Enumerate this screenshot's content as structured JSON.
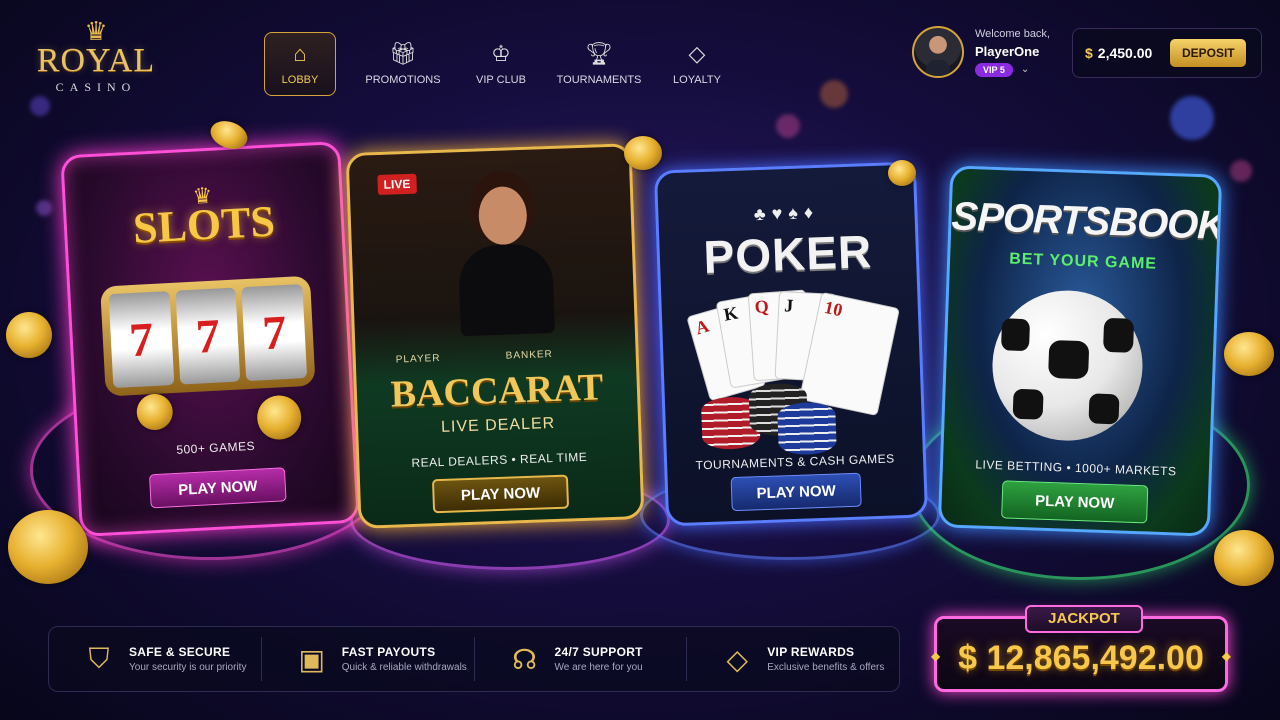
{
  "brand": {
    "name": "ROYAL",
    "tagline": "CASINO"
  },
  "nav": [
    {
      "label": "LOBBY",
      "icon": "house-icon",
      "active": true
    },
    {
      "label": "PROMOTIONS",
      "icon": "gift-icon"
    },
    {
      "label": "VIP CLUB",
      "icon": "crown-icon"
    },
    {
      "label": "TOURNAMENTS",
      "icon": "trophy-icon"
    },
    {
      "label": "LOYALTY",
      "icon": "diamond-icon"
    }
  ],
  "user": {
    "welcome": "Welcome back,",
    "name": "PlayerOne",
    "vip": "VIP 5"
  },
  "wallet": {
    "currency": "$",
    "balance": "2,450.00",
    "deposit_label": "DEPOSIT"
  },
  "cards": {
    "slots": {
      "title": "SLOTS",
      "subtitle": "500+ GAMES",
      "button": "PLAY NOW",
      "reels": [
        "7",
        "7",
        "7"
      ]
    },
    "baccarat": {
      "badge": "LIVE",
      "title": "BACCARAT",
      "tagline": "LIVE DEALER",
      "felt_left": "PLAYER",
      "felt_right": "BANKER",
      "subtitle": "REAL DEALERS • REAL TIME",
      "button": "PLAY NOW"
    },
    "poker": {
      "suits": "♣♥♠♦",
      "title": "POKER",
      "subtitle": "TOURNAMENTS & CASH GAMES",
      "button": "PLAY NOW",
      "cards": [
        "A",
        "K",
        "Q",
        "J",
        "10"
      ]
    },
    "sportsbook": {
      "title": "SPORTSBOOK",
      "tagline": "BET YOUR GAME",
      "subtitle": "LIVE BETTING • 1000+ MARKETS",
      "button": "PLAY NOW"
    }
  },
  "features": [
    {
      "title": "SAFE & SECURE",
      "desc": "Your security is our priority",
      "icon": "shield-icon"
    },
    {
      "title": "FAST PAYOUTS",
      "desc": "Quick & reliable withdrawals",
      "icon": "wallet-icon"
    },
    {
      "title": "24/7 SUPPORT",
      "desc": "We are here for you",
      "icon": "headset-icon"
    },
    {
      "title": "VIP REWARDS",
      "desc": "Exclusive benefits & offers",
      "icon": "diamond-icon"
    }
  ],
  "jackpot": {
    "label": "JACKPOT",
    "amount": "$ 12,865,492.00"
  },
  "colors": {
    "gold": "#f3c95a",
    "slots": "#ff4fd8",
    "baccarat": "#e8b84a",
    "poker": "#5b7dff",
    "sportsbook": "#56a8ff",
    "vip": "#8a2be2"
  }
}
